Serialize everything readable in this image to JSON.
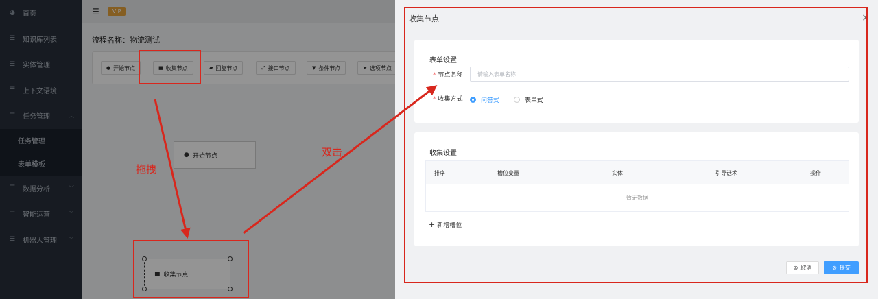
{
  "sidebar": {
    "items": [
      {
        "label": "首页",
        "icon": "dashboard-icon"
      },
      {
        "label": "知识库列表",
        "icon": "list-icon"
      },
      {
        "label": "实体管理",
        "icon": "list-icon"
      },
      {
        "label": "上下文语境",
        "icon": "list-icon"
      },
      {
        "label": "任务管理",
        "icon": "list-icon",
        "expanded": true
      },
      {
        "label": "数据分析",
        "icon": "list-icon"
      },
      {
        "label": "智能运营",
        "icon": "list-icon"
      },
      {
        "label": "机器人管理",
        "icon": "list-icon"
      }
    ],
    "subitems": [
      "任务管理",
      "表单模板"
    ]
  },
  "topbar": {
    "vip": "VIP"
  },
  "flow": {
    "name_label": "流程名称：物流测试"
  },
  "toolbar": {
    "buttons": [
      "开始节点",
      "收集节点",
      "回复节点",
      "接口节点",
      "条件节点",
      "选项节点"
    ]
  },
  "canvas": {
    "start_node": "开始节点",
    "collect_node": "收集节点"
  },
  "annotations": {
    "drag": "拖拽",
    "dblclick": "双击"
  },
  "drawer": {
    "title": "收集节点",
    "close": "×",
    "form_settings": {
      "title": "表单设置",
      "name_label": "节点名称",
      "name_placeholder": "请输入表单名称",
      "name_value": "",
      "method_label": "收集方式",
      "options": [
        "问答式",
        "表单式"
      ],
      "selected": "问答式"
    },
    "collect_settings": {
      "title": "收集设置",
      "columns": [
        "排序",
        "槽位变量",
        "实体",
        "引导话术",
        "操作"
      ],
      "empty_text": "暂无数据",
      "add_label": "新增槽位"
    },
    "cancel_label": "取消",
    "submit_label": "提交"
  },
  "colors": {
    "accent": "#409eff",
    "annotation": "#d8271d",
    "sidebar": "#28303b"
  }
}
